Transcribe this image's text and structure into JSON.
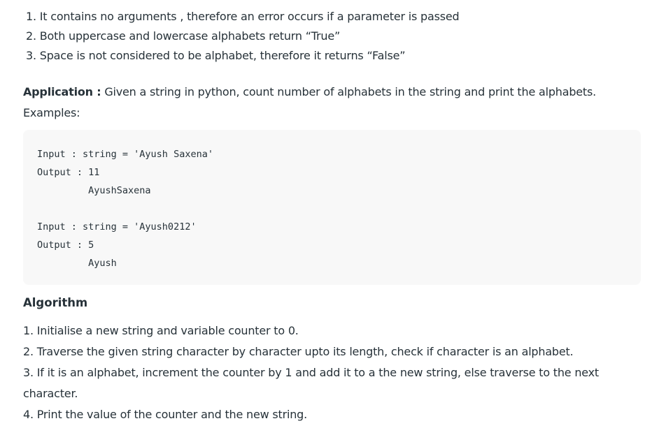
{
  "properties": [
    "1. It contains no arguments , therefore an error occurs if a parameter is passed",
    "2. Both uppercase and lowercase alphabets return “True”",
    "3. Space is not considered to be alphabet, therefore it returns “False”"
  ],
  "application": {
    "label": "Application :",
    "text": " Given a string in python, count number of alphabets in the string and print the alphabets."
  },
  "examples_label": "Examples:",
  "code_block": "Input : string = 'Ayush Saxena'\nOutput : 11\n         AyushSaxena\n\nInput : string = 'Ayush0212'\nOutput : 5\n         Ayush",
  "algorithm": {
    "title": "Algorithm",
    "steps": [
      "1. Initialise a new string and variable counter to 0.",
      "2. Traverse the given string character by character upto its length, check if character is an alphabet.",
      "3. If it is an alphabet, increment the counter by 1 and add it to a the new string, else traverse to the next character.",
      "4. Print the value of the counter and the new string."
    ]
  }
}
